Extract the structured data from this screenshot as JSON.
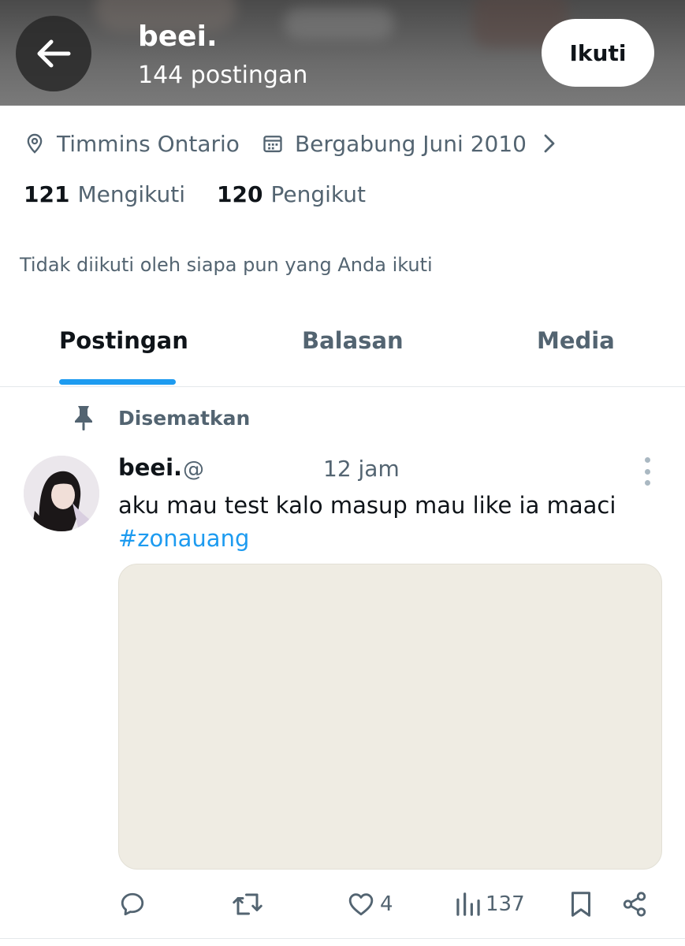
{
  "header": {
    "name": "beei.",
    "post_count": "144 postingan",
    "follow_label": "Ikuti"
  },
  "profile": {
    "location": "Timmins Ontario",
    "joined": "Bergabung Juni 2010",
    "following_count": "121",
    "following_label": "Mengikuti",
    "followers_count": "120",
    "followers_label": "Pengikut",
    "followed_by_text": "Tidak diikuti oleh siapa pun yang Anda ikuti"
  },
  "tabs": [
    {
      "label": "Postingan",
      "active": true
    },
    {
      "label": "Balasan",
      "active": false
    },
    {
      "label": "Media",
      "active": false
    }
  ],
  "post": {
    "pinned_label": "Disematkan",
    "author_name": "beei.",
    "handle": "@",
    "time": "12 jam",
    "text": "aku mau test kalo masup mau like ia maaci",
    "hashtag": "#zonauang",
    "actions": {
      "reply_count": "",
      "repost_count": "",
      "like_count": "4",
      "views_count": "137"
    }
  },
  "colors": {
    "accent": "#1d9bf0",
    "secondary_text": "#536471",
    "primary_text": "#0f1419"
  }
}
